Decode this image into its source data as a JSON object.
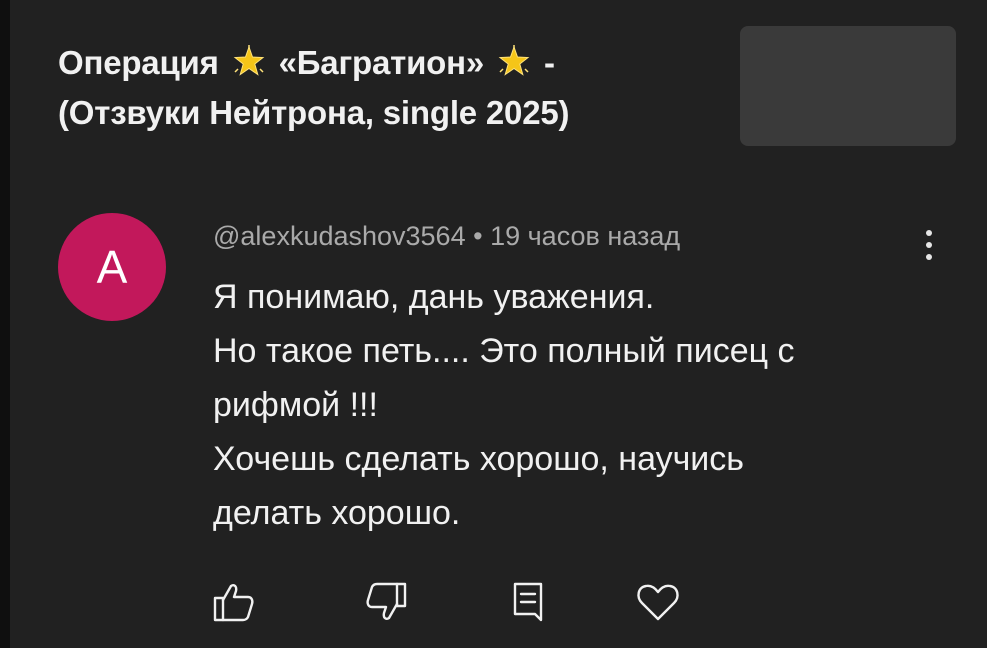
{
  "video": {
    "title_line1_part1": "Операция",
    "title_line1_part2": "«Багратион»",
    "title_line1_part3": "-",
    "title_line2": "(Отзвуки Нейтрона, single 2025)"
  },
  "comment": {
    "avatar_letter": "A",
    "author": "@alexkudashov3564",
    "separator": "•",
    "time": "19 часов назад",
    "lines": [
      "Я понимаю, дань уважения.",
      "Но такое петь.... Это полный писец с",
      "рифмой !!!",
      "Хочешь сделать хорошо, научись",
      "делать хорошо."
    ]
  },
  "icons": {
    "title_emoji": "star-icon",
    "more": "more-vert-icon",
    "like": "thumb-up-icon",
    "dislike": "thumb-down-icon",
    "reply": "reply-icon",
    "heart": "heart-icon"
  },
  "colors": {
    "background": "#212121",
    "avatar": "#c2185b",
    "meta_text": "#aaaaaa",
    "star": "#f5c518"
  }
}
